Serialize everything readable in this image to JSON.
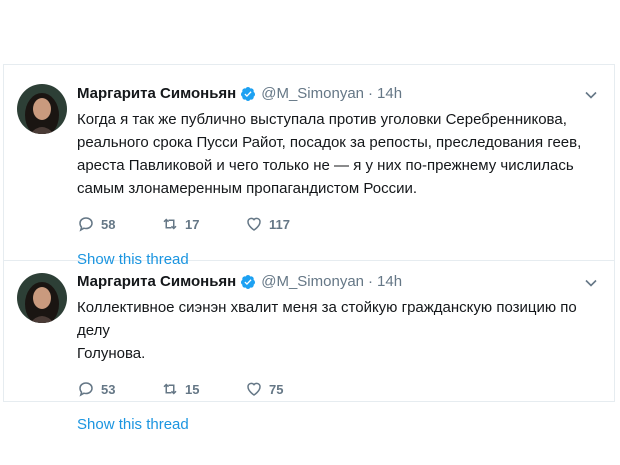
{
  "tweets": [
    {
      "author_name": "Маргарита Симоньян",
      "handle": "@M_Simonyan",
      "separator": "·",
      "time": "14h",
      "lines": [
        "Когда я так же публично выступала против уголовки Серебренникова,",
        "реального срока Пусси Райот, посадок за репосты, преследования геев,",
        "ареста Павликовой и чего только не — я у них по-прежнему числилась",
        "самым злонамеренным пропагандистом России."
      ],
      "replies": "58",
      "retweets": "17",
      "likes": "117",
      "thread_link": "Show this thread"
    },
    {
      "author_name": "Маргарита Симоньян",
      "handle": "@M_Simonyan",
      "separator": "·",
      "time": "14h",
      "lines": [
        "Коллективное сиэнэн хвалит меня за стойкую гражданскую позицию по делу",
        "Голунова."
      ],
      "replies": "53",
      "retweets": "15",
      "likes": "75",
      "thread_link": "Show this thread"
    }
  ],
  "colors": {
    "text": "#14171a",
    "secondary": "#657786",
    "link": "#1b95e0",
    "verified": "#1da1f2",
    "divider": "#e6ecf0"
  },
  "icons": [
    "verified-badge-icon",
    "chevron-down-icon",
    "reply-icon",
    "retweet-icon",
    "like-icon"
  ]
}
